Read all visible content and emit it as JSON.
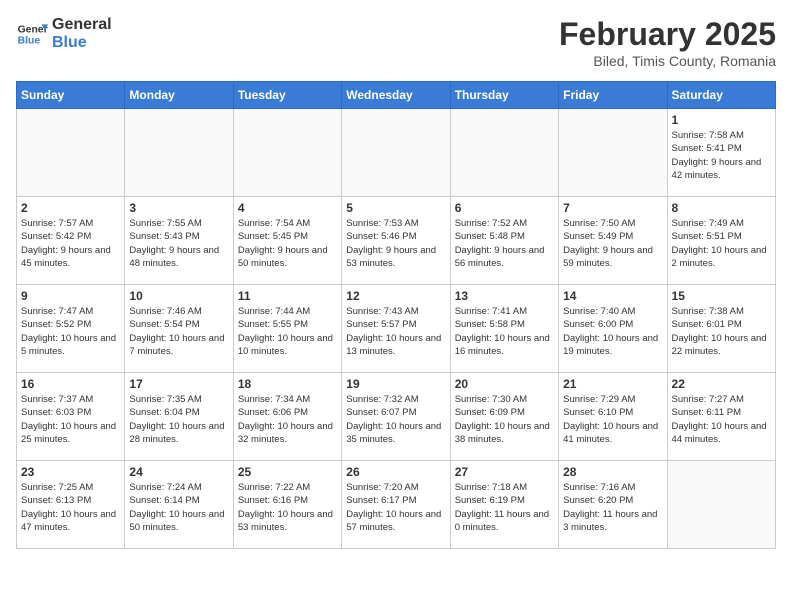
{
  "header": {
    "logo_general": "General",
    "logo_blue": "Blue",
    "month_title": "February 2025",
    "subtitle": "Biled, Timis County, Romania"
  },
  "weekdays": [
    "Sunday",
    "Monday",
    "Tuesday",
    "Wednesday",
    "Thursday",
    "Friday",
    "Saturday"
  ],
  "weeks": [
    [
      {
        "day": "",
        "info": ""
      },
      {
        "day": "",
        "info": ""
      },
      {
        "day": "",
        "info": ""
      },
      {
        "day": "",
        "info": ""
      },
      {
        "day": "",
        "info": ""
      },
      {
        "day": "",
        "info": ""
      },
      {
        "day": "1",
        "info": "Sunrise: 7:58 AM\nSunset: 5:41 PM\nDaylight: 9 hours and 42 minutes."
      }
    ],
    [
      {
        "day": "2",
        "info": "Sunrise: 7:57 AM\nSunset: 5:42 PM\nDaylight: 9 hours and 45 minutes."
      },
      {
        "day": "3",
        "info": "Sunrise: 7:55 AM\nSunset: 5:43 PM\nDaylight: 9 hours and 48 minutes."
      },
      {
        "day": "4",
        "info": "Sunrise: 7:54 AM\nSunset: 5:45 PM\nDaylight: 9 hours and 50 minutes."
      },
      {
        "day": "5",
        "info": "Sunrise: 7:53 AM\nSunset: 5:46 PM\nDaylight: 9 hours and 53 minutes."
      },
      {
        "day": "6",
        "info": "Sunrise: 7:52 AM\nSunset: 5:48 PM\nDaylight: 9 hours and 56 minutes."
      },
      {
        "day": "7",
        "info": "Sunrise: 7:50 AM\nSunset: 5:49 PM\nDaylight: 9 hours and 59 minutes."
      },
      {
        "day": "8",
        "info": "Sunrise: 7:49 AM\nSunset: 5:51 PM\nDaylight: 10 hours and 2 minutes."
      }
    ],
    [
      {
        "day": "9",
        "info": "Sunrise: 7:47 AM\nSunset: 5:52 PM\nDaylight: 10 hours and 5 minutes."
      },
      {
        "day": "10",
        "info": "Sunrise: 7:46 AM\nSunset: 5:54 PM\nDaylight: 10 hours and 7 minutes."
      },
      {
        "day": "11",
        "info": "Sunrise: 7:44 AM\nSunset: 5:55 PM\nDaylight: 10 hours and 10 minutes."
      },
      {
        "day": "12",
        "info": "Sunrise: 7:43 AM\nSunset: 5:57 PM\nDaylight: 10 hours and 13 minutes."
      },
      {
        "day": "13",
        "info": "Sunrise: 7:41 AM\nSunset: 5:58 PM\nDaylight: 10 hours and 16 minutes."
      },
      {
        "day": "14",
        "info": "Sunrise: 7:40 AM\nSunset: 6:00 PM\nDaylight: 10 hours and 19 minutes."
      },
      {
        "day": "15",
        "info": "Sunrise: 7:38 AM\nSunset: 6:01 PM\nDaylight: 10 hours and 22 minutes."
      }
    ],
    [
      {
        "day": "16",
        "info": "Sunrise: 7:37 AM\nSunset: 6:03 PM\nDaylight: 10 hours and 25 minutes."
      },
      {
        "day": "17",
        "info": "Sunrise: 7:35 AM\nSunset: 6:04 PM\nDaylight: 10 hours and 28 minutes."
      },
      {
        "day": "18",
        "info": "Sunrise: 7:34 AM\nSunset: 6:06 PM\nDaylight: 10 hours and 32 minutes."
      },
      {
        "day": "19",
        "info": "Sunrise: 7:32 AM\nSunset: 6:07 PM\nDaylight: 10 hours and 35 minutes."
      },
      {
        "day": "20",
        "info": "Sunrise: 7:30 AM\nSunset: 6:09 PM\nDaylight: 10 hours and 38 minutes."
      },
      {
        "day": "21",
        "info": "Sunrise: 7:29 AM\nSunset: 6:10 PM\nDaylight: 10 hours and 41 minutes."
      },
      {
        "day": "22",
        "info": "Sunrise: 7:27 AM\nSunset: 6:11 PM\nDaylight: 10 hours and 44 minutes."
      }
    ],
    [
      {
        "day": "23",
        "info": "Sunrise: 7:25 AM\nSunset: 6:13 PM\nDaylight: 10 hours and 47 minutes."
      },
      {
        "day": "24",
        "info": "Sunrise: 7:24 AM\nSunset: 6:14 PM\nDaylight: 10 hours and 50 minutes."
      },
      {
        "day": "25",
        "info": "Sunrise: 7:22 AM\nSunset: 6:16 PM\nDaylight: 10 hours and 53 minutes."
      },
      {
        "day": "26",
        "info": "Sunrise: 7:20 AM\nSunset: 6:17 PM\nDaylight: 10 hours and 57 minutes."
      },
      {
        "day": "27",
        "info": "Sunrise: 7:18 AM\nSunset: 6:19 PM\nDaylight: 11 hours and 0 minutes."
      },
      {
        "day": "28",
        "info": "Sunrise: 7:16 AM\nSunset: 6:20 PM\nDaylight: 11 hours and 3 minutes."
      },
      {
        "day": "",
        "info": ""
      }
    ]
  ]
}
